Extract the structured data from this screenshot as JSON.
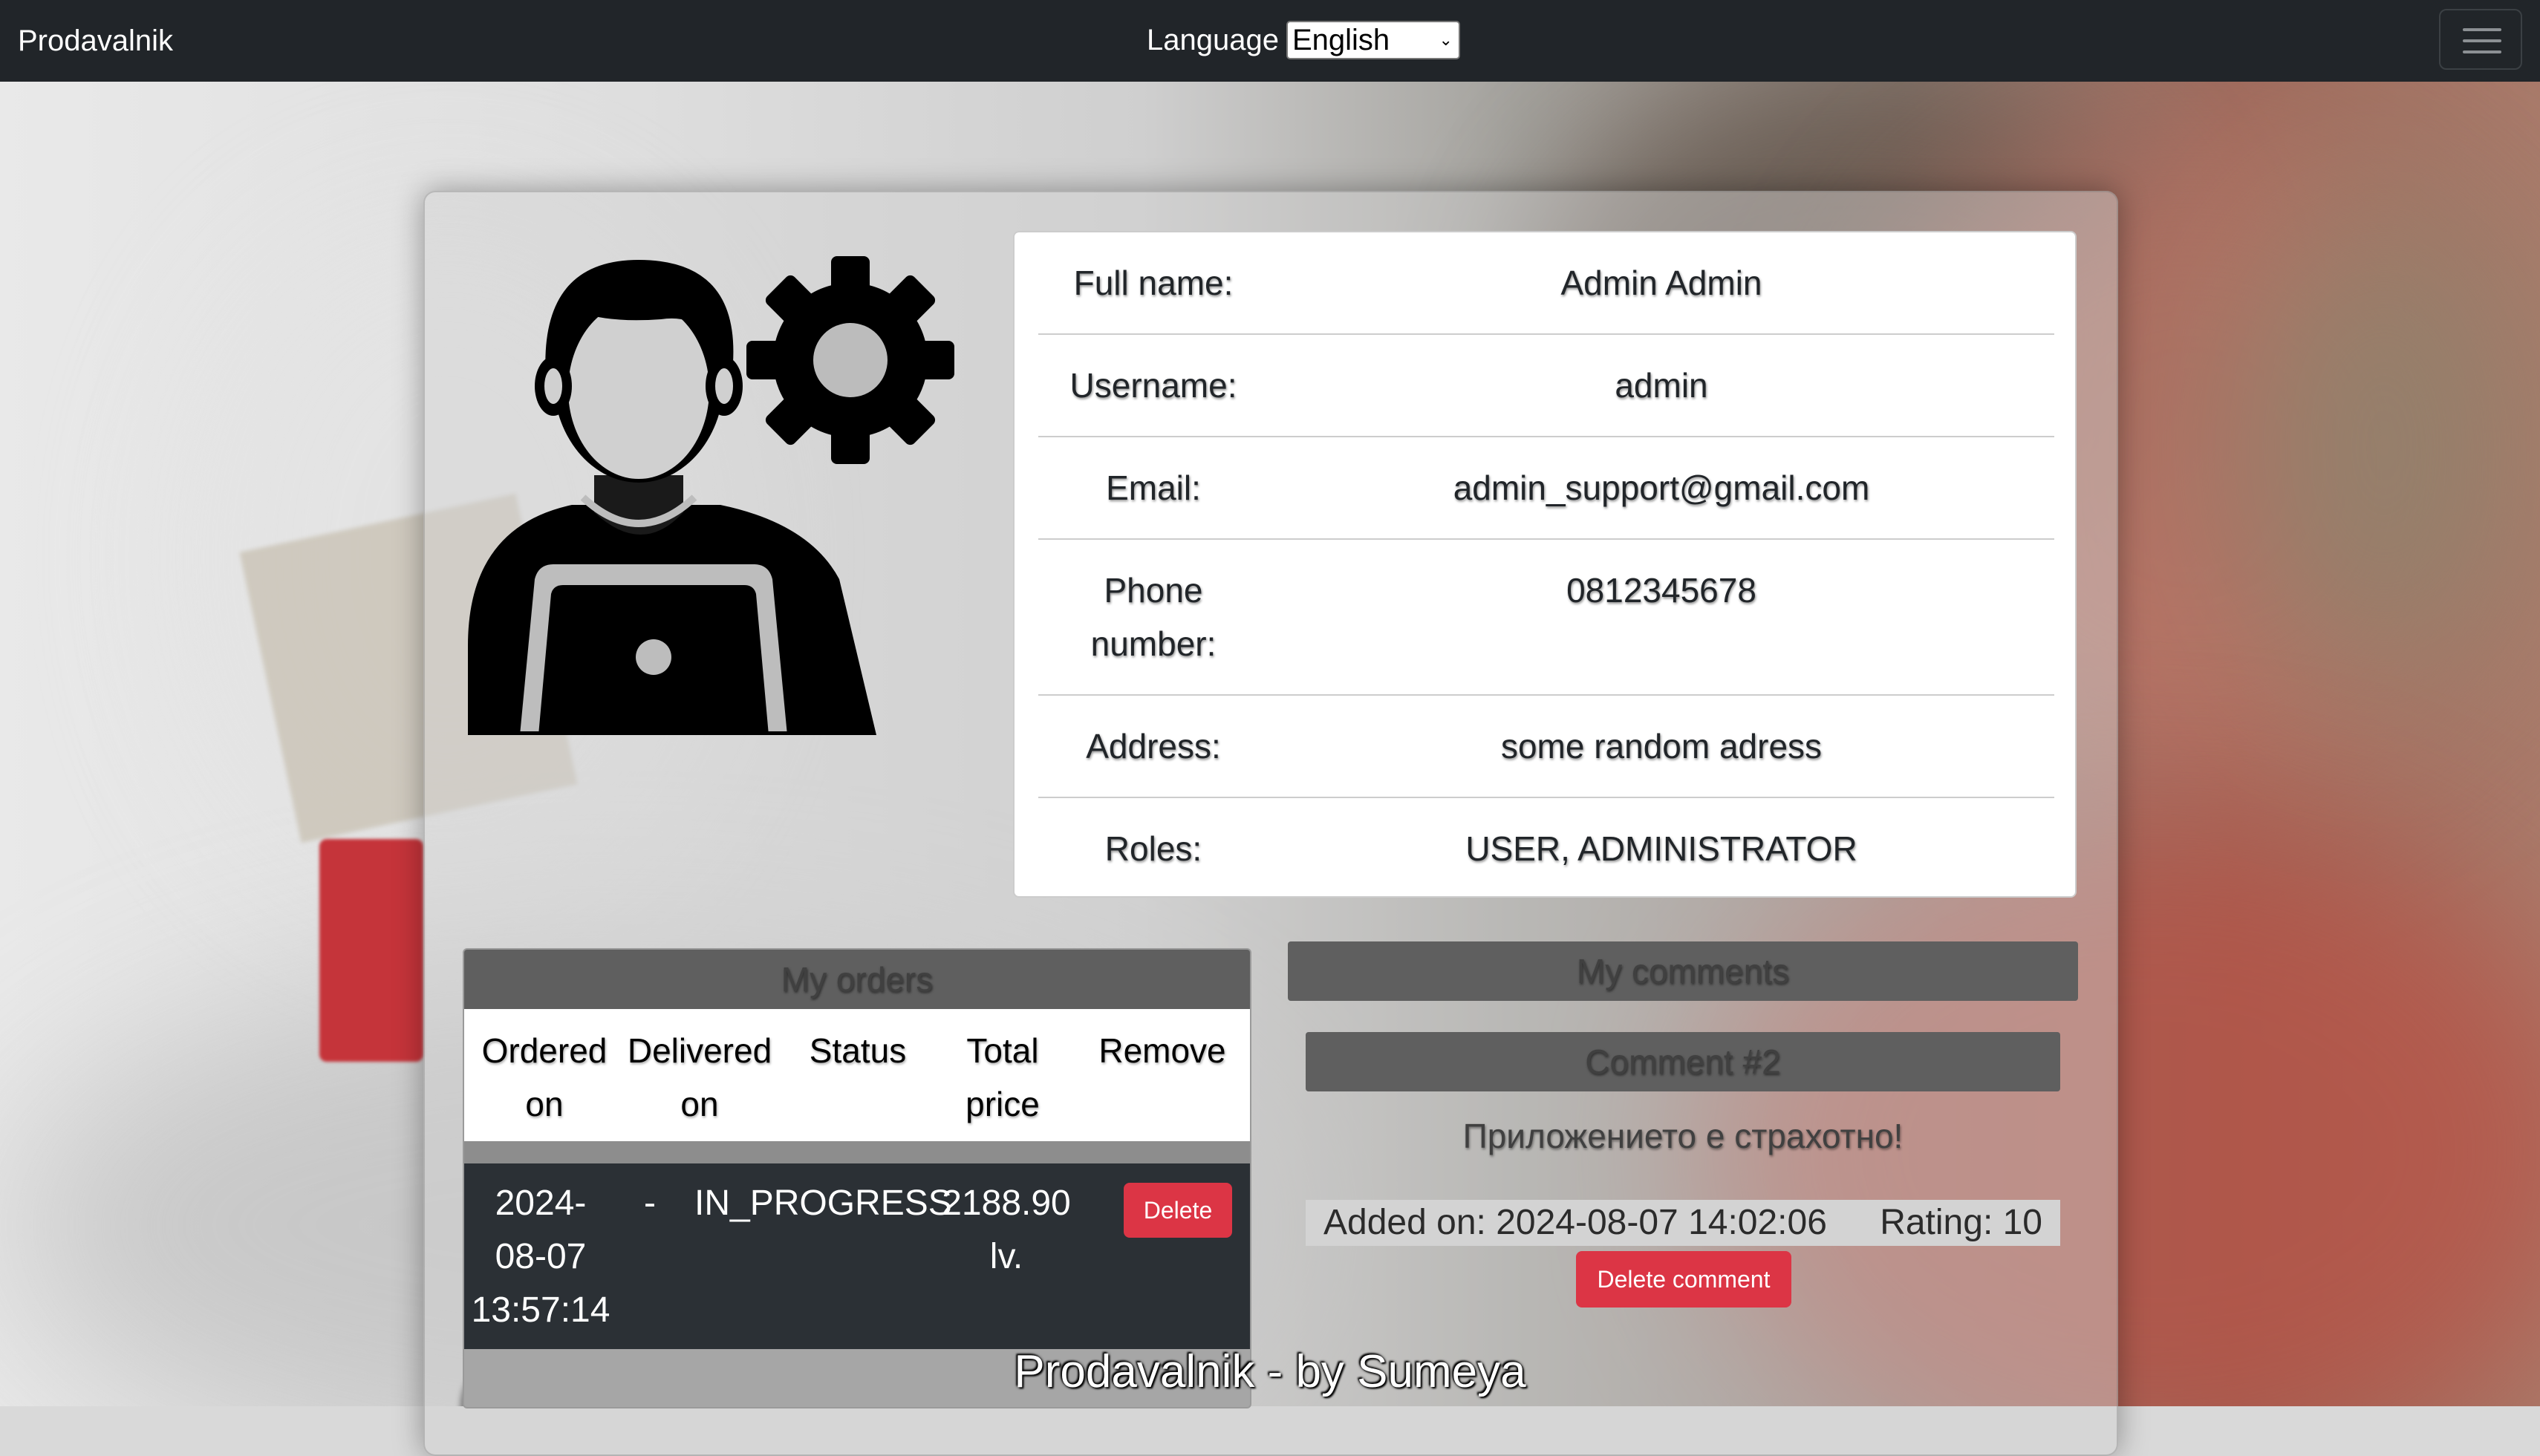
{
  "navbar": {
    "brand": "Prodavalnik",
    "language_label": "Language",
    "language_selected": "English"
  },
  "profile": {
    "rows": [
      {
        "label": "Full name:",
        "value": "Admin Admin"
      },
      {
        "label": "Username:",
        "value": "admin"
      },
      {
        "label": "Email:",
        "value": "admin_support@gmail.com"
      },
      {
        "label": "Phone number:",
        "value": "0812345678"
      },
      {
        "label": "Address:",
        "value": "some random adress"
      },
      {
        "label": "Roles:",
        "value": "USER, ADMINISTRATOR"
      }
    ]
  },
  "orders": {
    "title": "My orders",
    "columns": [
      "Ordered on",
      "Delivered on",
      "Status",
      "Total price",
      "Remove"
    ],
    "rows": [
      {
        "ordered_on": "2024-08-07 13:57:14",
        "delivered_on": "-",
        "status": "IN_PROGRESS",
        "total_price": "2188.90 lv.",
        "remove_label": "Delete"
      }
    ]
  },
  "comments": {
    "title": "My comments",
    "items": [
      {
        "heading": "Comment #2",
        "text": "Приложението е страхотно!",
        "added_on": "Added on: 2024-08-07 14:02:06",
        "rating": "Rating: 10",
        "delete_label": "Delete comment"
      }
    ]
  },
  "footer": {
    "text": "Prodavalnik - by Sumeya"
  },
  "colors": {
    "navbar_bg": "#212529",
    "danger": "#dc3545",
    "section_header_bg": "#5f5f5f",
    "order_row_bg": "#2b3035"
  }
}
